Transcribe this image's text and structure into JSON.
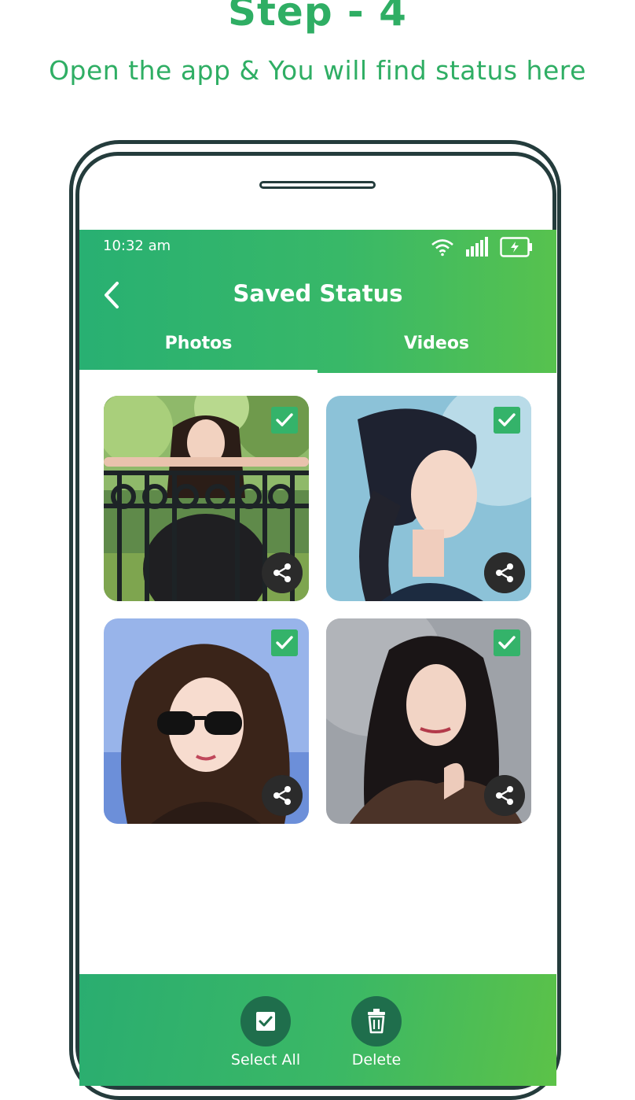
{
  "header": {
    "step_title": "Step - 4",
    "step_subtitle": "Open the app & You will find status here"
  },
  "status_bar": {
    "time": "10:32 am",
    "icons": [
      "wifi-icon",
      "signal-icon",
      "battery-charging-icon"
    ]
  },
  "app_bar": {
    "back_icon": "chevron-left-icon",
    "title": "Saved Status"
  },
  "tabs": [
    {
      "label": "Photos",
      "selected": true
    },
    {
      "label": "Videos",
      "selected": false
    }
  ],
  "gallery": {
    "items": [
      {
        "checked": true,
        "share_icon": "share-icon"
      },
      {
        "checked": true,
        "share_icon": "share-icon"
      },
      {
        "checked": true,
        "share_icon": "share-icon"
      },
      {
        "checked": true,
        "share_icon": "share-icon"
      }
    ]
  },
  "bottom_bar": {
    "select_all_label": "Select All",
    "delete_label": "Delete"
  },
  "colors": {
    "brand_green": "#2fae64",
    "appbar_start": "#28b072",
    "appbar_end": "#57c24e",
    "phone_frame": "#243c3c"
  }
}
